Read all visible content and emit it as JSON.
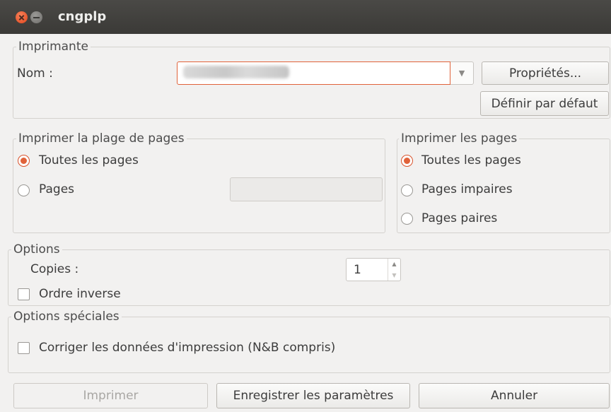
{
  "window": {
    "title": "cngplp"
  },
  "printer": {
    "legend": "Imprimante",
    "name_label": "Nom :",
    "name_value": "",
    "properties_button": "Propriétés...",
    "default_button": "Définir par défaut"
  },
  "page_range": {
    "legend": "Imprimer la plage de pages",
    "all_pages": "Toutes les pages",
    "pages": "Pages",
    "pages_value": ""
  },
  "print_pages": {
    "legend": "Imprimer les pages",
    "all_pages": "Toutes les pages",
    "odd_pages": "Pages impaires",
    "even_pages": "Pages paires"
  },
  "options": {
    "legend": "Options",
    "copies_label": "Copies :",
    "copies_value": "1",
    "reverse_order": "Ordre inverse"
  },
  "special_options": {
    "legend": "Options spéciales",
    "correct_data": "Corriger les données d'impression (N&B compris)"
  },
  "buttons": {
    "print": "Imprimer",
    "save_settings": "Enregistrer les paramètres",
    "cancel": "Annuler"
  },
  "colors": {
    "accent": "#e0623a",
    "titlebar": "#3b3a37"
  }
}
